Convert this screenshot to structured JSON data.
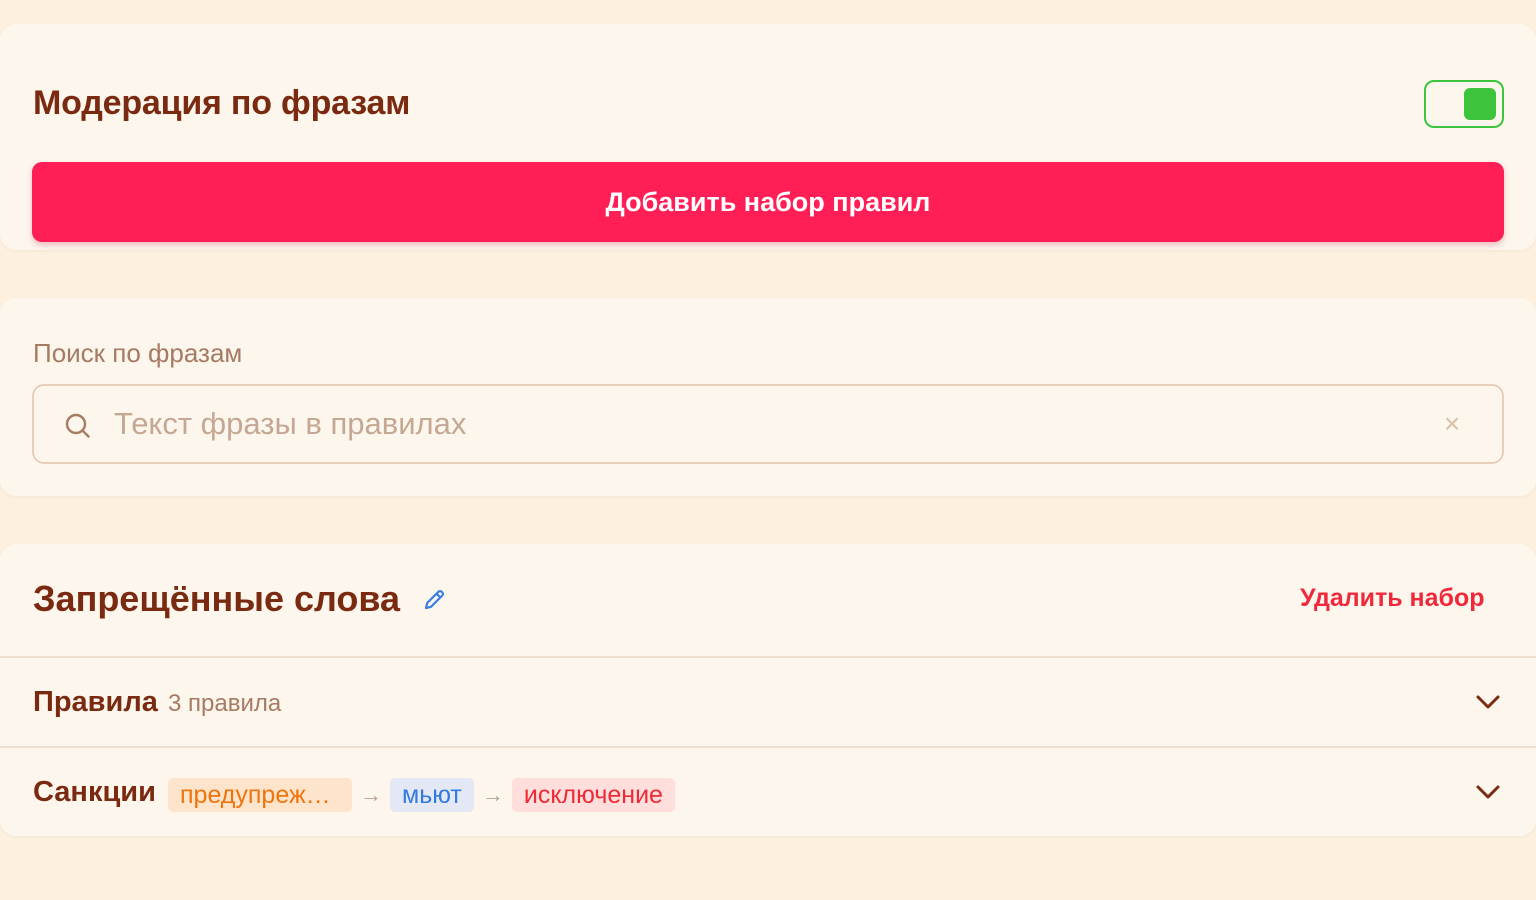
{
  "moderation": {
    "title": "Модерация по фразам",
    "enabled": true,
    "add_button_label": "Добавить набор правил"
  },
  "search": {
    "label": "Поиск по фразам",
    "placeholder": "Текст фразы в правилах",
    "value": ""
  },
  "ruleset": {
    "name": "Запрещённые слова",
    "delete_label": "Удалить набор",
    "rules": {
      "label": "Правила",
      "count": "3 правила"
    },
    "sanctions": {
      "label": "Санкции",
      "steps": [
        "предупреж…",
        "мьют",
        "исключение"
      ]
    }
  },
  "colors": {
    "background": "#fdf0df",
    "card": "#fdf6ec",
    "primary": "#ff1e56",
    "title": "#7a2a10",
    "toggle_on": "#3cc43c",
    "danger": "#f0283c"
  },
  "icons": [
    "toggle-switch",
    "search-icon",
    "clear-icon",
    "pencil-icon",
    "arrow-right-icon",
    "chevron-down-icon"
  ]
}
